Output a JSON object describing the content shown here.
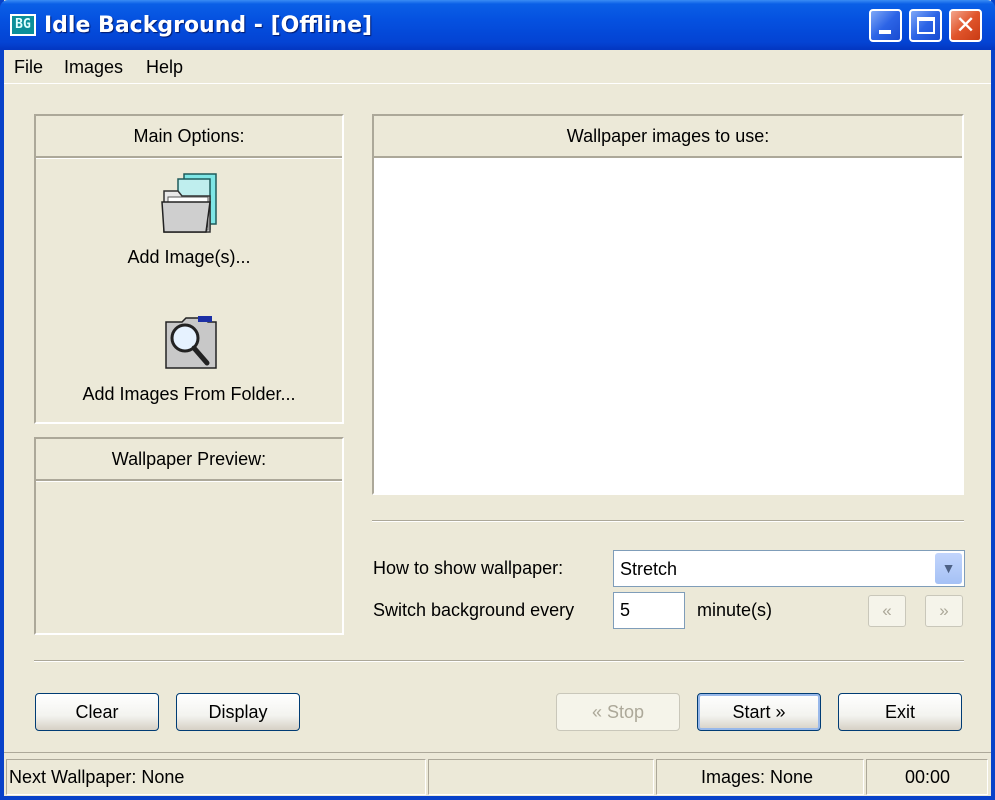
{
  "window": {
    "title": "Idle Background - [Offline]",
    "app_icon_text": "BG"
  },
  "menu": [
    "File",
    "Images",
    "Help"
  ],
  "main_options": {
    "header": "Main Options:",
    "add_images_label": "Add Image(s)...",
    "add_folder_label": "Add Images From Folder..."
  },
  "preview": {
    "header": "Wallpaper Preview:"
  },
  "images_list": {
    "header": "Wallpaper images to use:"
  },
  "settings": {
    "show_label": "How to show wallpaper:",
    "show_value": "Stretch",
    "switch_label": "Switch background every",
    "switch_value": "5",
    "unit_label": "minute(s)",
    "prev_label": "«",
    "next_label": "»"
  },
  "buttons": {
    "clear": "Clear",
    "display": "Display",
    "stop": "« Stop",
    "start": "Start »",
    "exit": "Exit"
  },
  "status": {
    "next_wallpaper": "Next Wallpaper:  None",
    "images": "Images:  None",
    "time": "00:00"
  }
}
